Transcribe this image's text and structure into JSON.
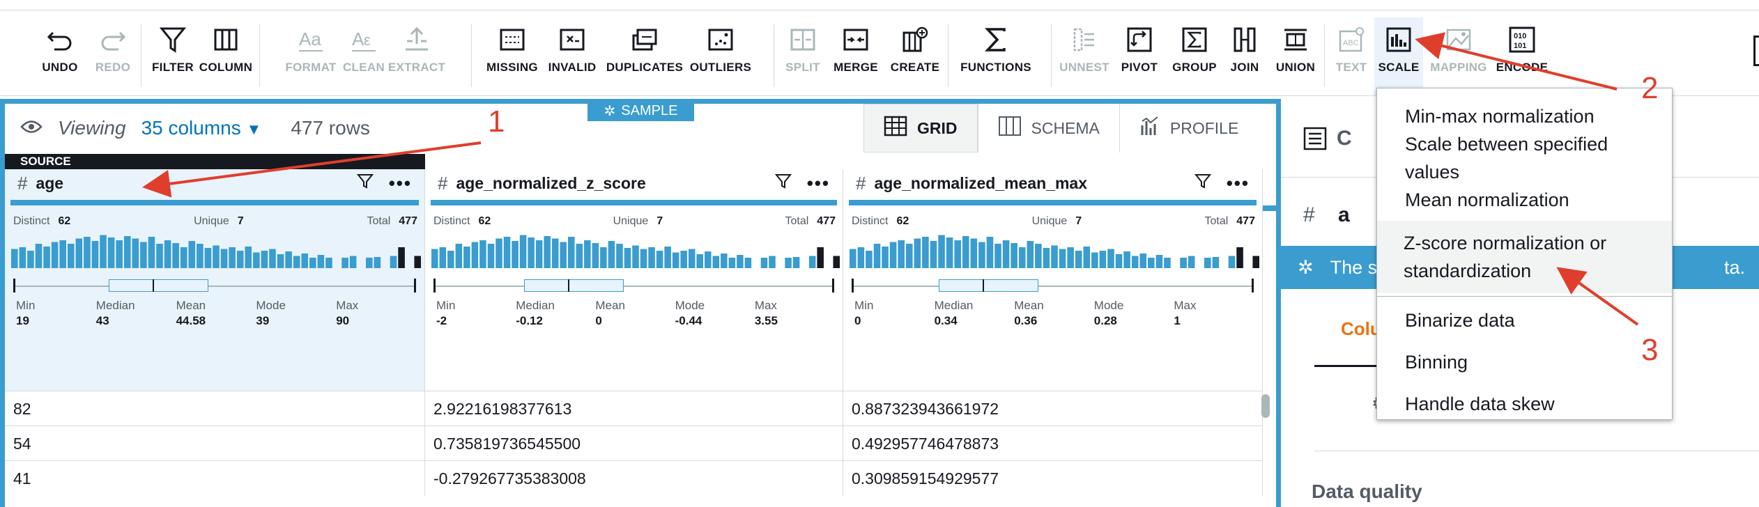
{
  "toolbar": {
    "groups": [
      [
        {
          "label": "UNDO",
          "icon": "undo-icon"
        },
        {
          "label": "REDO",
          "icon": "redo-icon",
          "disabled": true
        }
      ],
      [
        {
          "label": "FILTER",
          "icon": "filter-icon"
        },
        {
          "label": "COLUMN",
          "icon": "column-icon"
        }
      ],
      [
        {
          "label": "FORMAT",
          "icon": "format-icon",
          "disabled": true
        },
        {
          "label": "CLEAN",
          "icon": "clean-icon",
          "disabled": true
        },
        {
          "label": "EXTRACT",
          "icon": "extract-icon",
          "disabled": true
        }
      ],
      [
        {
          "label": "MISSING",
          "icon": "missing-icon"
        },
        {
          "label": "INVALID",
          "icon": "invalid-icon"
        },
        {
          "label": "DUPLICATES",
          "icon": "duplicates-icon"
        },
        {
          "label": "OUTLIERS",
          "icon": "outliers-icon"
        }
      ],
      [
        {
          "label": "SPLIT",
          "icon": "split-icon",
          "disabled": true
        },
        {
          "label": "MERGE",
          "icon": "merge-icon"
        },
        {
          "label": "CREATE",
          "icon": "create-icon"
        }
      ],
      [
        {
          "label": "FUNCTIONS",
          "icon": "sigma-icon"
        }
      ],
      [
        {
          "label": "UNNEST",
          "icon": "unnest-icon",
          "disabled": true
        },
        {
          "label": "PIVOT",
          "icon": "pivot-icon"
        },
        {
          "label": "GROUP",
          "icon": "group-icon"
        },
        {
          "label": "JOIN",
          "icon": "join-icon"
        },
        {
          "label": "UNION",
          "icon": "union-icon"
        }
      ],
      [
        {
          "label": "TEXT",
          "icon": "text-icon",
          "disabled": true
        },
        {
          "label": "SCALE",
          "icon": "scale-icon",
          "active": true
        },
        {
          "label": "MAPPING",
          "icon": "mapping-icon",
          "disabled": true
        },
        {
          "label": "ENCODE",
          "icon": "encode-icon"
        }
      ]
    ]
  },
  "viewing": {
    "label": "Viewing",
    "columns": "35 columns",
    "rows": "477 rows"
  },
  "sample_label": "SAMPLE",
  "view_tabs": [
    {
      "label": "GRID",
      "active": true
    },
    {
      "label": "SCHEMA"
    },
    {
      "label": "PROFILE"
    }
  ],
  "source_label": "SOURCE",
  "stat_labels": {
    "distinct": "Distinct",
    "unique": "Unique",
    "total": "Total",
    "min": "Min",
    "median": "Median",
    "mean": "Mean",
    "mode": "Mode",
    "max": "Max"
  },
  "columns": [
    {
      "name": "age",
      "distinct": "62",
      "unique": "7",
      "total": "477",
      "min": "19",
      "median": "43",
      "mean": "44.58",
      "mode": "39",
      "max": "90"
    },
    {
      "name": "age_normalized_z_score",
      "distinct": "62",
      "unique": "7",
      "total": "477",
      "min": "-2",
      "median": "-0.12",
      "mean": "0",
      "mode": "-0.44",
      "max": "3.55"
    },
    {
      "name": "age_normalized_mean_max",
      "distinct": "62",
      "unique": "7",
      "total": "477",
      "min": "0",
      "median": "0.34",
      "mean": "0.36",
      "mode": "0.28",
      "max": "1"
    }
  ],
  "rows": [
    [
      "82",
      "2.92216198377613",
      "0.887323943661972"
    ],
    [
      "54",
      "0.735819736545500",
      "0.492957746478873"
    ],
    [
      "41",
      "-0.279267735383008",
      "0.309859154929577"
    ]
  ],
  "right_panel": {
    "banner_start": "The s",
    "banner_end": "ta.",
    "tab_partial": "Colu",
    "data_quality": "Data quality",
    "header_partial": "C",
    "field_partial": "a"
  },
  "scale_menu": {
    "items": [
      "Min-max normalization",
      "Scale between specified values",
      "Mean normalization"
    ],
    "highlighted": [
      "Z-score normalization or",
      "standardization"
    ],
    "items2": [
      "Binarize data",
      "Binning",
      "Handle data skew"
    ]
  },
  "annotations": {
    "a1": "1",
    "a2": "2",
    "a3": "3"
  },
  "colors": {
    "accent": "#3a9ccf",
    "link": "#0073bb",
    "annotation": "#e03e2d",
    "tab_orange": "#ec7211"
  }
}
